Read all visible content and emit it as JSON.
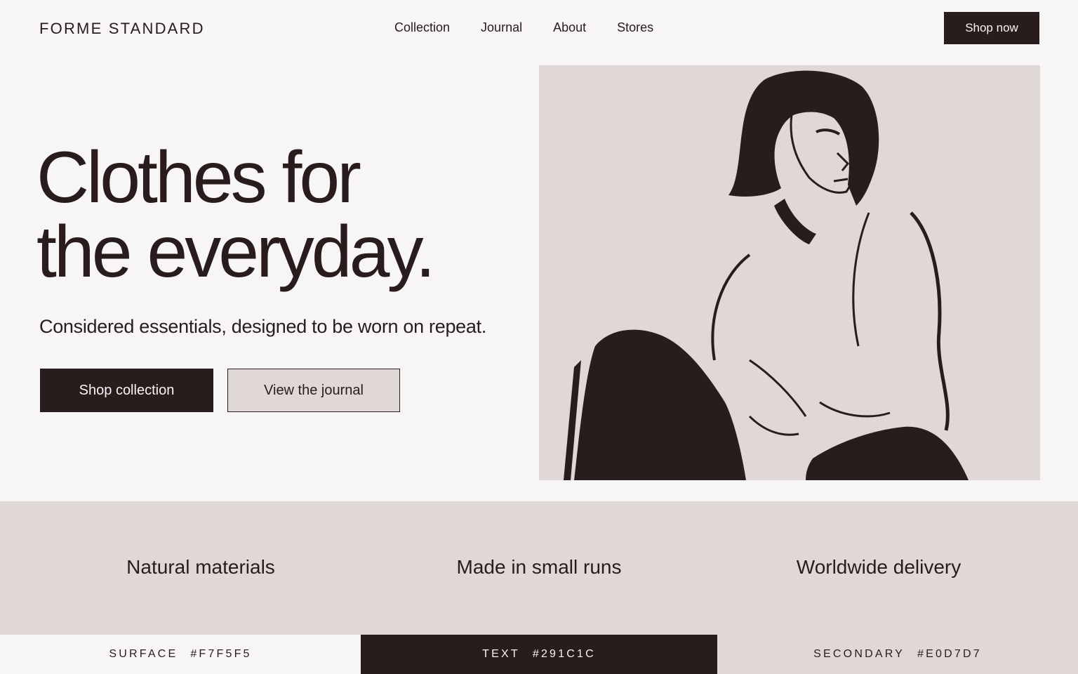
{
  "header": {
    "logo": "FORME STANDARD",
    "nav": [
      "Collection",
      "Journal",
      "About",
      "Stores"
    ],
    "cta": "Shop now"
  },
  "hero": {
    "title_line1": "Clothes for",
    "title_line2": "the everyday.",
    "subtitle": "Considered essentials, designed to be worn on repeat.",
    "primary_button": "Shop collection",
    "secondary_button": "View the journal"
  },
  "features": [
    "Natural materials",
    "Made in small runs",
    "Worldwide delivery"
  ],
  "swatches": [
    {
      "name": "SURFACE",
      "hex": "#F7F5F5"
    },
    {
      "name": "TEXT",
      "hex": "#291C1C"
    },
    {
      "name": "SECONDARY",
      "hex": "#E0D7D7"
    }
  ],
  "colors": {
    "surface": "#F7F5F5",
    "text": "#291C1C",
    "secondary": "#E0D7D7"
  }
}
